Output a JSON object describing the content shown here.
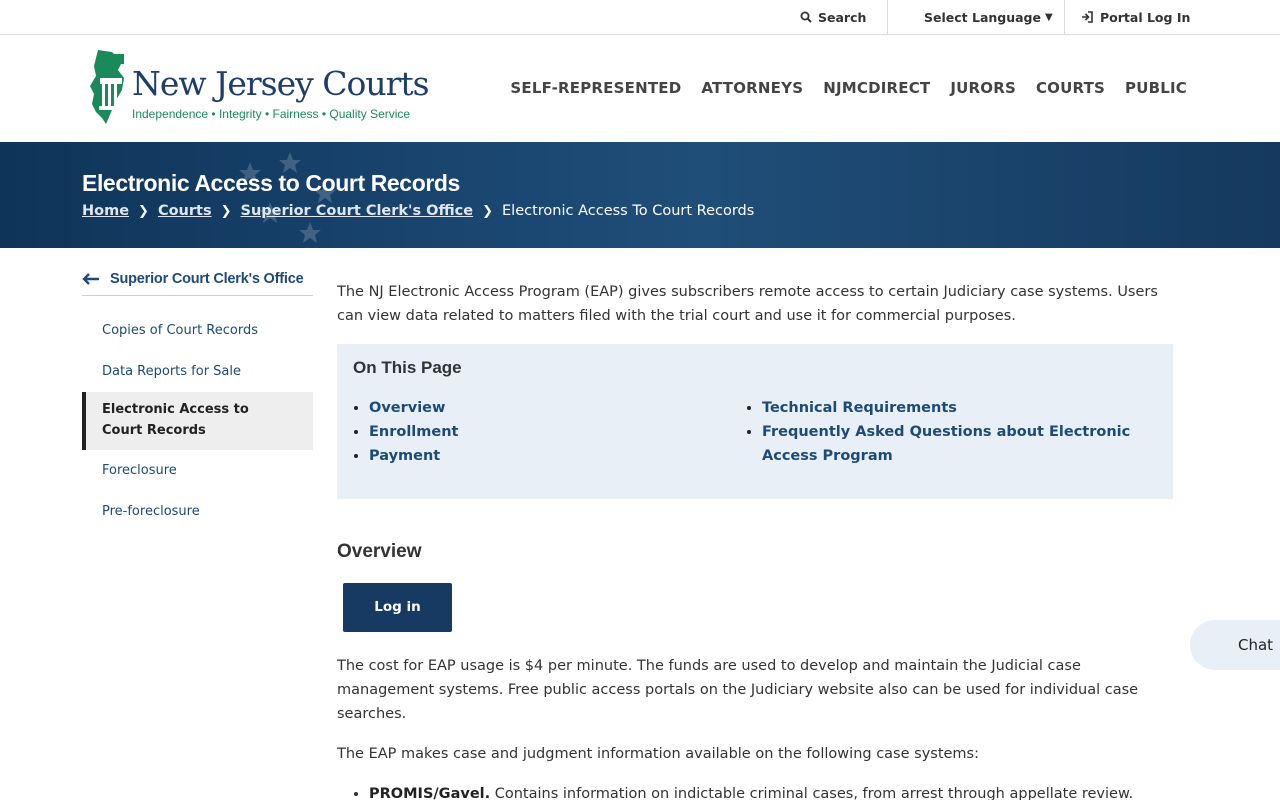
{
  "utility": {
    "search_label": "Search",
    "language_label": "Select Language",
    "portal_label": "Portal Log In"
  },
  "logo": {
    "name": "New Jersey Courts",
    "tagline": "Independence • Integrity • Fairness • Quality Service",
    "color_primary": "#1d3d6b",
    "color_accent": "#1b8a5a"
  },
  "nav": {
    "items": [
      "SELF-REPRESENTED",
      "ATTORNEYS",
      "NJMCDIRECT",
      "JURORS",
      "COURTS",
      "PUBLIC"
    ]
  },
  "banner": {
    "title": "Electronic Access to Court Records",
    "breadcrumb": [
      "Home",
      "Courts",
      "Superior Court Clerk's Office"
    ],
    "breadcrumb_current": "Electronic Access To Court Records"
  },
  "sidebar": {
    "back_label": "Superior Court Clerk's Office",
    "items": [
      "Copies of Court Records",
      "Data Reports for Sale",
      "Electronic Access to Court Records",
      "Foreclosure",
      "Pre-foreclosure"
    ]
  },
  "content": {
    "intro": "The NJ Electronic Access Program (EAP) gives subscribers remote access to certain Judiciary case systems. Users can view data related to matters filed with the trial court and use it for commercial purposes.",
    "otp_title": "On This Page",
    "otp_col1": [
      "Overview",
      "Enrollment",
      "Payment"
    ],
    "otp_col2": [
      "Technical Requirements",
      "Frequently Asked Questions about Electronic Access Program"
    ],
    "section_title": "Overview",
    "login_label": "Log in",
    "para1": "The cost for EAP usage is $4 per minute. The funds are used to develop and maintain the Judicial case management systems. Free public access portals on the Judiciary website also can be used for individual case searches.",
    "para2": "The EAP makes case and judgment information available on the following case systems:",
    "systems": [
      {
        "name": "PROMIS/Gavel.",
        "desc": " Contains information on indictable criminal cases, from arrest through appellate review."
      }
    ]
  },
  "chat": {
    "label": "Chat"
  }
}
